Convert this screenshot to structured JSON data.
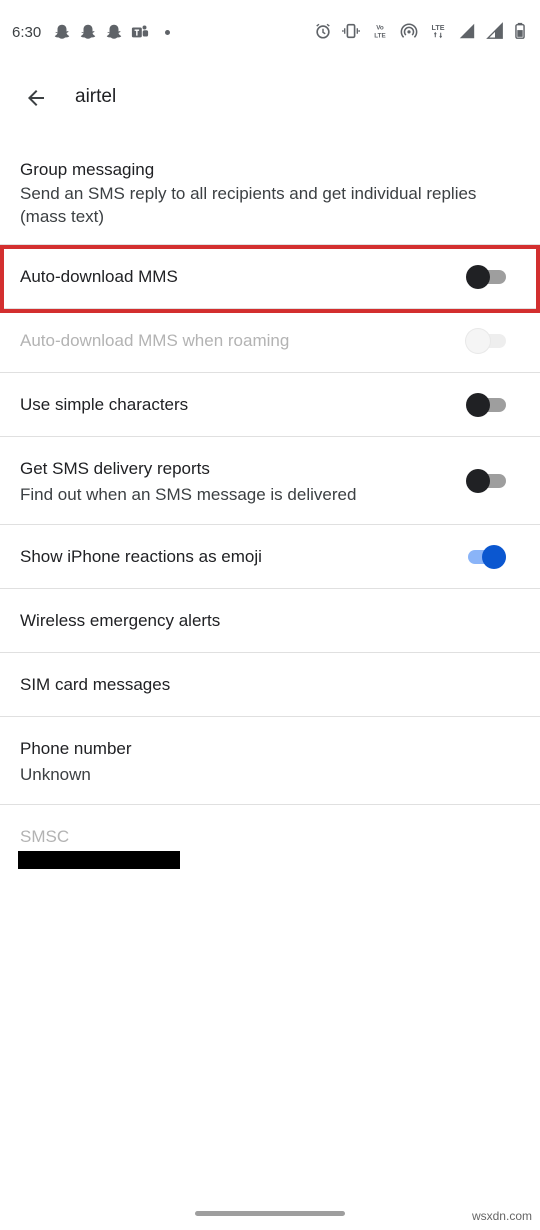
{
  "status_bar": {
    "time": "6:30",
    "left_icons": [
      "snapchat-icon",
      "snapchat-icon",
      "snapchat-icon",
      "teams-icon"
    ],
    "right_icons": [
      "alarm-icon",
      "vibrate-icon",
      "volte-icon",
      "hotspot-icon",
      "lte-signal-icon",
      "signal-icon",
      "battery-icon"
    ],
    "volte_text": "Vo LTE",
    "lte_text": "LTE"
  },
  "app_bar": {
    "title": "airtel"
  },
  "settings": [
    {
      "title": "Group messaging",
      "subtitle": "Send an SMS reply to all recipients and get individual replies (mass text)"
    },
    {
      "title": "Auto-download MMS",
      "toggle": false
    },
    {
      "title": "Auto-download MMS when roaming",
      "toggle": false,
      "disabled": true
    },
    {
      "title": "Use simple characters",
      "toggle": false
    },
    {
      "title": "Get SMS delivery reports",
      "subtitle": "Find out when an SMS message is delivered",
      "toggle": false
    },
    {
      "title": "Show iPhone reactions as emoji",
      "toggle": true
    },
    {
      "title": "Wireless emergency alerts"
    },
    {
      "title": "SIM card messages"
    },
    {
      "title": "Phone number",
      "subtitle": "Unknown"
    },
    {
      "title": "SMSC",
      "disabled": true
    }
  ],
  "watermark": "wsxdn.com",
  "colors": {
    "accent": "#0b57d0",
    "highlight": "#d32f2f"
  }
}
